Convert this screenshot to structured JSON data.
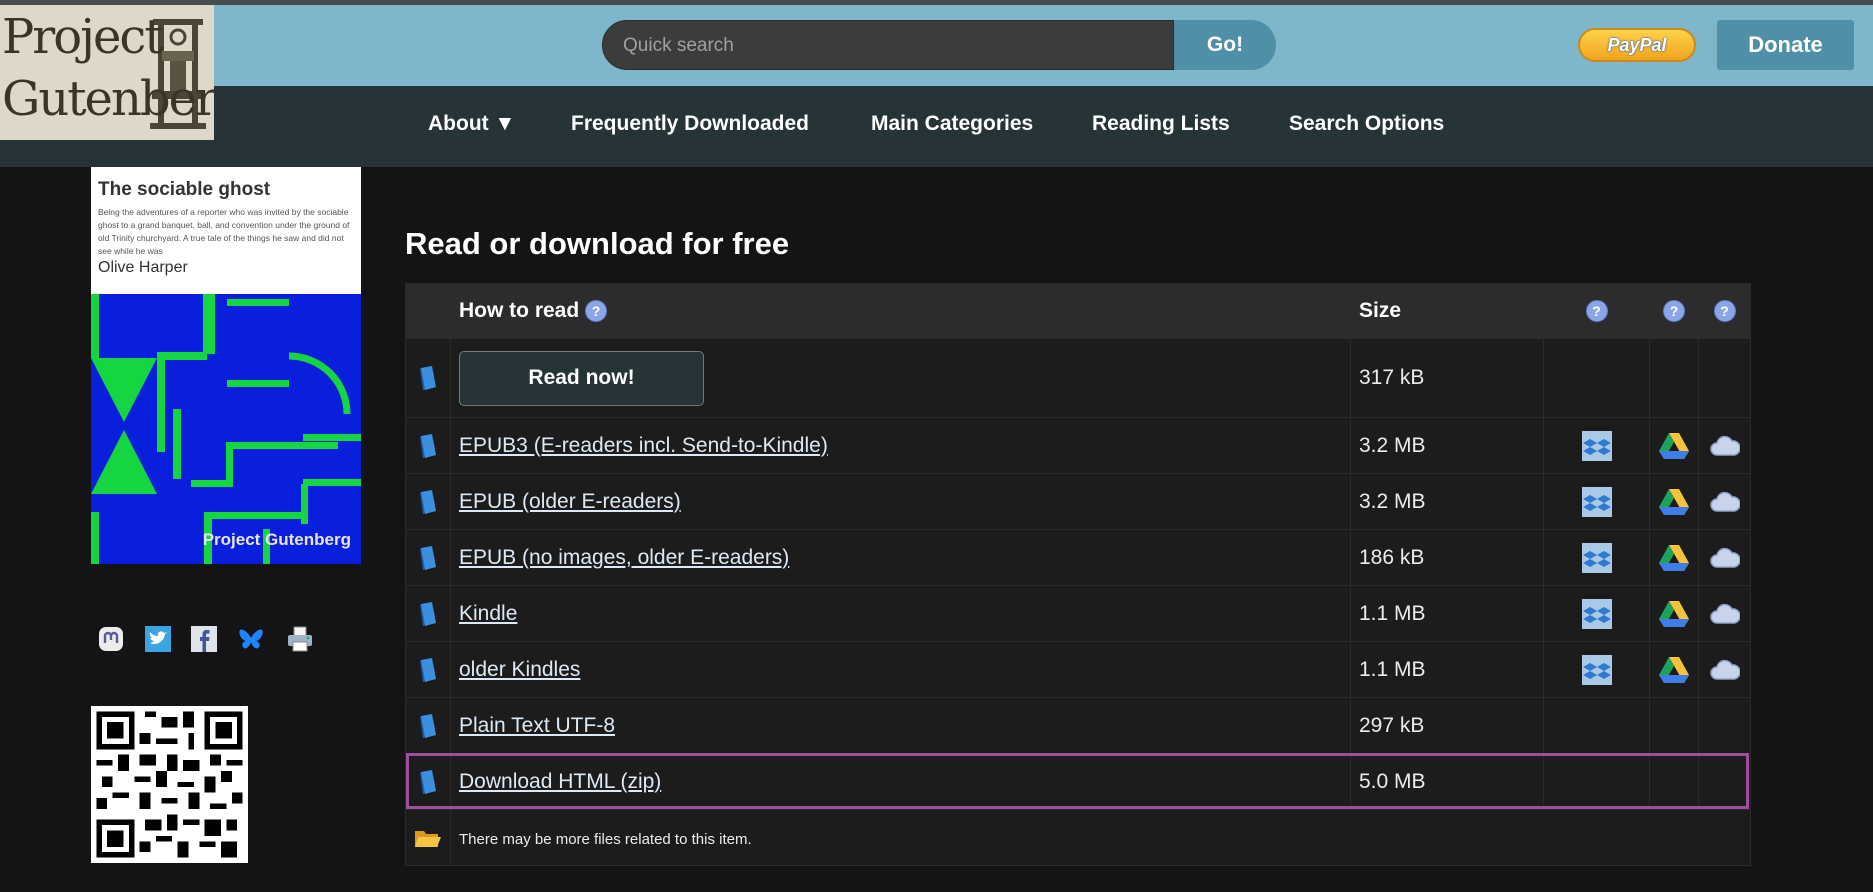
{
  "header": {
    "logo_line1": "Project",
    "logo_line2": "Gutenberg",
    "search_placeholder": "Quick search",
    "go_label": "Go!",
    "paypal_label": "PayPal",
    "donate_label": "Donate"
  },
  "nav": {
    "items": [
      {
        "label": "About ▼"
      },
      {
        "label": "Frequently Downloaded"
      },
      {
        "label": "Main Categories"
      },
      {
        "label": "Reading Lists"
      },
      {
        "label": "Search Options"
      }
    ]
  },
  "cover": {
    "title": "The sociable ghost",
    "description": "Being the adventures of a reporter who was invited by the sociable ghost to a grand banquet, ball, and convention under the ground of old Trinity churchyard. A true tale of the things he saw and did not see while he was",
    "author": "Olive Harper",
    "brand": "Project Gutenberg"
  },
  "social": [
    "mastodon-icon",
    "twitter-icon",
    "facebook-icon",
    "bluesky-icon",
    "print-icon"
  ],
  "main": {
    "heading": "Read or download for free",
    "table": {
      "col_how": "How to read",
      "col_size": "Size",
      "help_glyph": "?",
      "read_now": {
        "label": "Read now!",
        "size": "317 kB"
      },
      "rows": [
        {
          "label": "EPUB3 (E-readers incl. Send-to-Kindle)",
          "size": "3.2 MB",
          "services": true
        },
        {
          "label": "EPUB (older E-readers)",
          "size": "3.2 MB",
          "services": true
        },
        {
          "label": "EPUB (no images, older E-readers)",
          "size": "186 kB",
          "services": true
        },
        {
          "label": "Kindle",
          "size": "1.1 MB",
          "services": true
        },
        {
          "label": "older Kindles",
          "size": "1.1 MB",
          "services": true
        },
        {
          "label": "Plain Text UTF-8",
          "size": "297 kB",
          "services": false
        },
        {
          "label": "Download HTML (zip)",
          "size": "5.0 MB",
          "services": false
        }
      ],
      "more_note": "There may be more files related to this item."
    }
  },
  "colors": {
    "header_bg": "#7eb6cb",
    "nav_bg": "#263437",
    "button_bg": "#4f8fa8",
    "page_bg": "#141416",
    "highlight": "#9d4e9d"
  }
}
